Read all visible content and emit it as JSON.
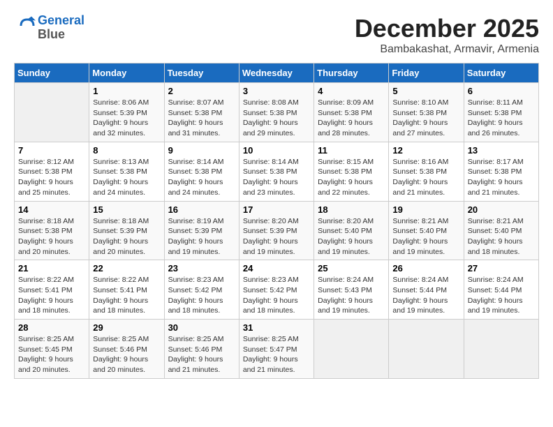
{
  "header": {
    "logo_line1": "General",
    "logo_line2": "Blue",
    "month": "December 2025",
    "location": "Bambakashat, Armavir, Armenia"
  },
  "days_of_week": [
    "Sunday",
    "Monday",
    "Tuesday",
    "Wednesday",
    "Thursday",
    "Friday",
    "Saturday"
  ],
  "weeks": [
    [
      {
        "num": "",
        "info": ""
      },
      {
        "num": "1",
        "info": "Sunrise: 8:06 AM\nSunset: 5:39 PM\nDaylight: 9 hours\nand 32 minutes."
      },
      {
        "num": "2",
        "info": "Sunrise: 8:07 AM\nSunset: 5:38 PM\nDaylight: 9 hours\nand 31 minutes."
      },
      {
        "num": "3",
        "info": "Sunrise: 8:08 AM\nSunset: 5:38 PM\nDaylight: 9 hours\nand 29 minutes."
      },
      {
        "num": "4",
        "info": "Sunrise: 8:09 AM\nSunset: 5:38 PM\nDaylight: 9 hours\nand 28 minutes."
      },
      {
        "num": "5",
        "info": "Sunrise: 8:10 AM\nSunset: 5:38 PM\nDaylight: 9 hours\nand 27 minutes."
      },
      {
        "num": "6",
        "info": "Sunrise: 8:11 AM\nSunset: 5:38 PM\nDaylight: 9 hours\nand 26 minutes."
      }
    ],
    [
      {
        "num": "7",
        "info": "Sunrise: 8:12 AM\nSunset: 5:38 PM\nDaylight: 9 hours\nand 25 minutes."
      },
      {
        "num": "8",
        "info": "Sunrise: 8:13 AM\nSunset: 5:38 PM\nDaylight: 9 hours\nand 24 minutes."
      },
      {
        "num": "9",
        "info": "Sunrise: 8:14 AM\nSunset: 5:38 PM\nDaylight: 9 hours\nand 24 minutes."
      },
      {
        "num": "10",
        "info": "Sunrise: 8:14 AM\nSunset: 5:38 PM\nDaylight: 9 hours\nand 23 minutes."
      },
      {
        "num": "11",
        "info": "Sunrise: 8:15 AM\nSunset: 5:38 PM\nDaylight: 9 hours\nand 22 minutes."
      },
      {
        "num": "12",
        "info": "Sunrise: 8:16 AM\nSunset: 5:38 PM\nDaylight: 9 hours\nand 21 minutes."
      },
      {
        "num": "13",
        "info": "Sunrise: 8:17 AM\nSunset: 5:38 PM\nDaylight: 9 hours\nand 21 minutes."
      }
    ],
    [
      {
        "num": "14",
        "info": "Sunrise: 8:18 AM\nSunset: 5:38 PM\nDaylight: 9 hours\nand 20 minutes."
      },
      {
        "num": "15",
        "info": "Sunrise: 8:18 AM\nSunset: 5:39 PM\nDaylight: 9 hours\nand 20 minutes."
      },
      {
        "num": "16",
        "info": "Sunrise: 8:19 AM\nSunset: 5:39 PM\nDaylight: 9 hours\nand 19 minutes."
      },
      {
        "num": "17",
        "info": "Sunrise: 8:20 AM\nSunset: 5:39 PM\nDaylight: 9 hours\nand 19 minutes."
      },
      {
        "num": "18",
        "info": "Sunrise: 8:20 AM\nSunset: 5:40 PM\nDaylight: 9 hours\nand 19 minutes."
      },
      {
        "num": "19",
        "info": "Sunrise: 8:21 AM\nSunset: 5:40 PM\nDaylight: 9 hours\nand 19 minutes."
      },
      {
        "num": "20",
        "info": "Sunrise: 8:21 AM\nSunset: 5:40 PM\nDaylight: 9 hours\nand 18 minutes."
      }
    ],
    [
      {
        "num": "21",
        "info": "Sunrise: 8:22 AM\nSunset: 5:41 PM\nDaylight: 9 hours\nand 18 minutes."
      },
      {
        "num": "22",
        "info": "Sunrise: 8:22 AM\nSunset: 5:41 PM\nDaylight: 9 hours\nand 18 minutes."
      },
      {
        "num": "23",
        "info": "Sunrise: 8:23 AM\nSunset: 5:42 PM\nDaylight: 9 hours\nand 18 minutes."
      },
      {
        "num": "24",
        "info": "Sunrise: 8:23 AM\nSunset: 5:42 PM\nDaylight: 9 hours\nand 18 minutes."
      },
      {
        "num": "25",
        "info": "Sunrise: 8:24 AM\nSunset: 5:43 PM\nDaylight: 9 hours\nand 19 minutes."
      },
      {
        "num": "26",
        "info": "Sunrise: 8:24 AM\nSunset: 5:44 PM\nDaylight: 9 hours\nand 19 minutes."
      },
      {
        "num": "27",
        "info": "Sunrise: 8:24 AM\nSunset: 5:44 PM\nDaylight: 9 hours\nand 19 minutes."
      }
    ],
    [
      {
        "num": "28",
        "info": "Sunrise: 8:25 AM\nSunset: 5:45 PM\nDaylight: 9 hours\nand 20 minutes."
      },
      {
        "num": "29",
        "info": "Sunrise: 8:25 AM\nSunset: 5:46 PM\nDaylight: 9 hours\nand 20 minutes."
      },
      {
        "num": "30",
        "info": "Sunrise: 8:25 AM\nSunset: 5:46 PM\nDaylight: 9 hours\nand 21 minutes."
      },
      {
        "num": "31",
        "info": "Sunrise: 8:25 AM\nSunset: 5:47 PM\nDaylight: 9 hours\nand 21 minutes."
      },
      {
        "num": "",
        "info": ""
      },
      {
        "num": "",
        "info": ""
      },
      {
        "num": "",
        "info": ""
      }
    ]
  ]
}
